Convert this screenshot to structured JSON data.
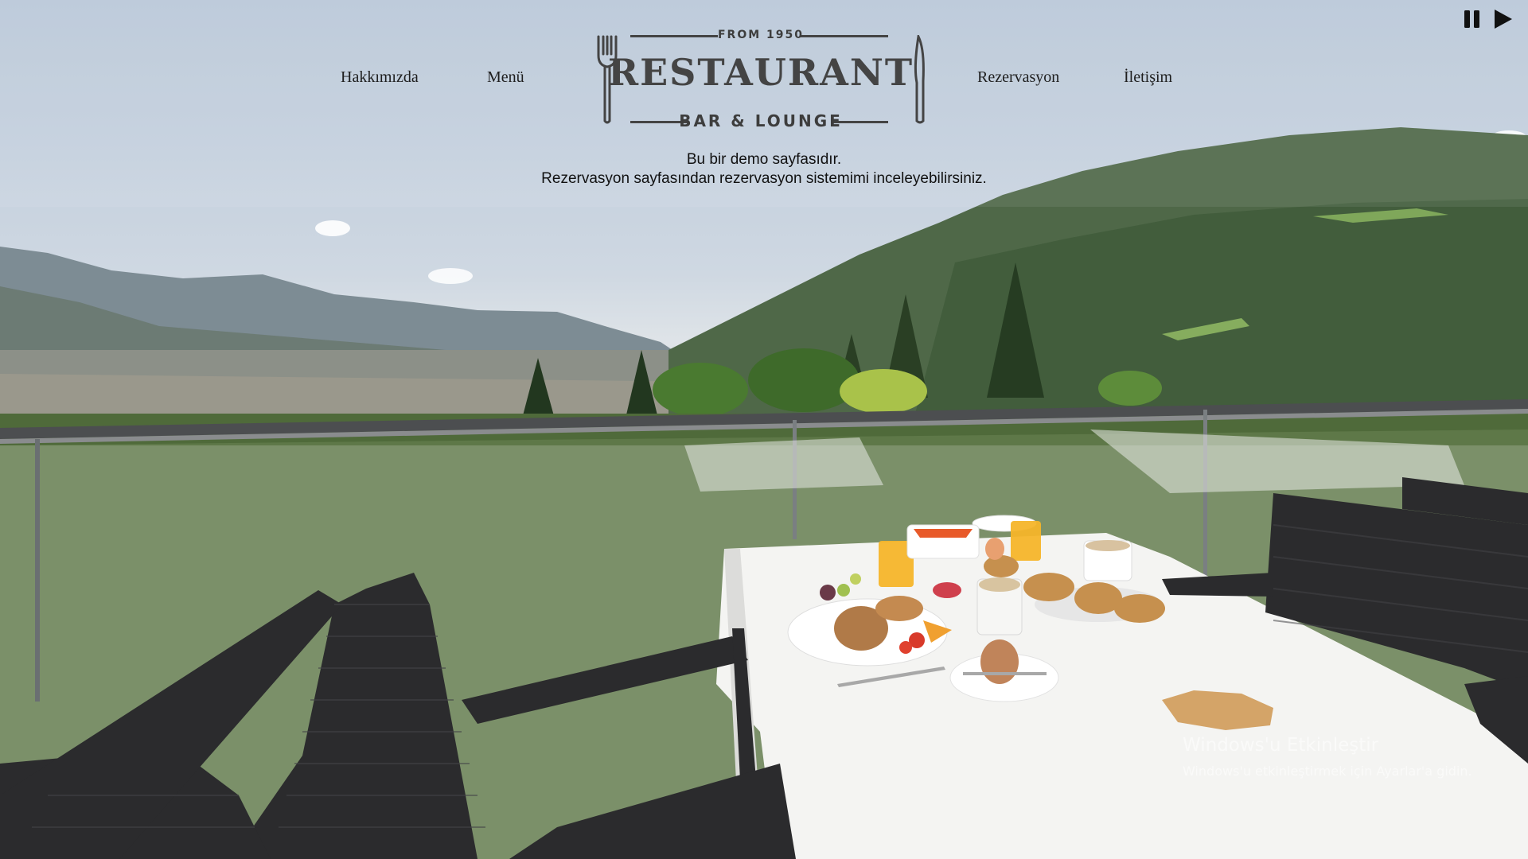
{
  "nav": {
    "left": [
      {
        "label": "Hakkımızda"
      },
      {
        "label": "Menü"
      }
    ],
    "right": [
      {
        "label": "Rezervasyon"
      },
      {
        "label": "İletişim"
      }
    ]
  },
  "logo": {
    "since": "FROM 1950",
    "title": "RESTAURANT",
    "subtitle": "BAR & LOUNGE"
  },
  "intro": {
    "line1": "Bu bir demo sayfasıdır.",
    "line2": "Rezervasyon sayfasından rezervasyon sistemimi inceleyebilirsiniz."
  },
  "slideshow": {
    "icons": [
      "pause-icon",
      "play-icon"
    ]
  },
  "watermark": {
    "title": "Windows'u Etkinleştir",
    "subtitle": "Windows'u etkinleştirmek için Ayarlar'a gidin."
  },
  "colors": {
    "text": "#1e1e1e",
    "logo": "#444444",
    "tablecloth": "#f4f4f2",
    "chair": "#2b2b2d"
  }
}
